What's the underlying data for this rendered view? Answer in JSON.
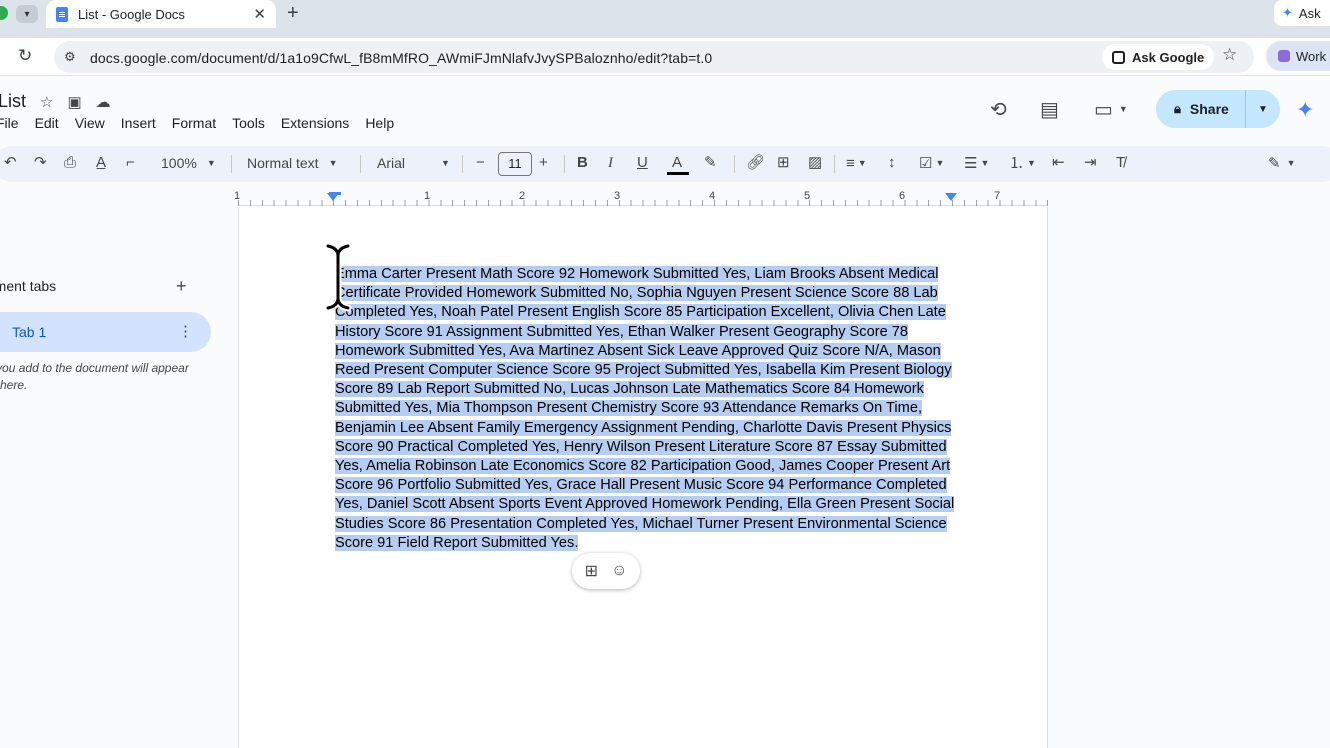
{
  "browser": {
    "tab_title": "List - Google Docs",
    "tab_close": "✕",
    "new_tab": "+",
    "ask_short": "Ask",
    "url": "docs.google.com/document/d/1a1o9CfwL_fB8mMfRO_AWmiFJmNlafvJvySPBaloznho/edit?tab=t.0",
    "ask_google": "Ask Google",
    "work_label": "Work"
  },
  "docs": {
    "title": "List",
    "menu": [
      "File",
      "Edit",
      "View",
      "Insert",
      "Format",
      "Tools",
      "Extensions",
      "Help"
    ],
    "share_label": "Share"
  },
  "toolbar": {
    "zoom": "100%",
    "style": "Normal text",
    "font": "Arial",
    "font_size": "11"
  },
  "ruler": {
    "numbers": [
      "1",
      "1",
      "2",
      "3",
      "4",
      "5",
      "6",
      "7"
    ]
  },
  "outline": {
    "heading": "Document tabs",
    "tab_label": "Tab 1",
    "note": "Headings you add to the document will appear here."
  },
  "document": {
    "body": "Emma Carter Present Math Score 92 Homework Submitted Yes, Liam Brooks Absent Medical Certificate Provided Homework Submitted No, Sophia Nguyen Present Science Score 88 Lab Completed Yes, Noah Patel Present English Score 85 Participation Excellent, Olivia Chen Late History Score 91 Assignment Submitted Yes, Ethan Walker Present Geography Score 78 Homework Submitted Yes, Ava Martinez Absent Sick Leave Approved Quiz Score N/A, Mason Reed Present Computer Science Score 95 Project Submitted Yes, Isabella Kim Present Biology Score 89 Lab Report Submitted No, Lucas Johnson Late Mathematics Score 84 Homework Submitted Yes, Mia Thompson Present Chemistry Score 93 Attendance Remarks On Time, Benjamin Lee Absent Family Emergency Assignment Pending, Charlotte Davis Present Physics Score 90 Practical Completed Yes, Henry Wilson Present Literature Score 87 Essay Submitted Yes, Amelia Robinson Late Economics Score 82 Participation Good, James Cooper Present Art Score 96 Portfolio Submitted Yes, Grace Hall Present Music Score 94 Performance Completed Yes, Daniel Scott Absent Sports Event Approved Homework Pending, Ella Green Present Social Studies Score 86 Presentation Completed Yes, Michael Turner Present Environmental Science Score 91 Field Report Submitted Yes."
  },
  "icons": {
    "reload": "reload-icon",
    "star": "star-icon",
    "history": "history-icon",
    "comments": "comment-icon",
    "meet": "video-icon",
    "lock": "lock-icon",
    "gemini": "gemini-spark-icon"
  },
  "colors": {
    "selection": "#b6cdf2",
    "share_bg": "#c2e7ff",
    "active_tab_bg": "#d3e3fd",
    "accent": "#0b57d0"
  }
}
